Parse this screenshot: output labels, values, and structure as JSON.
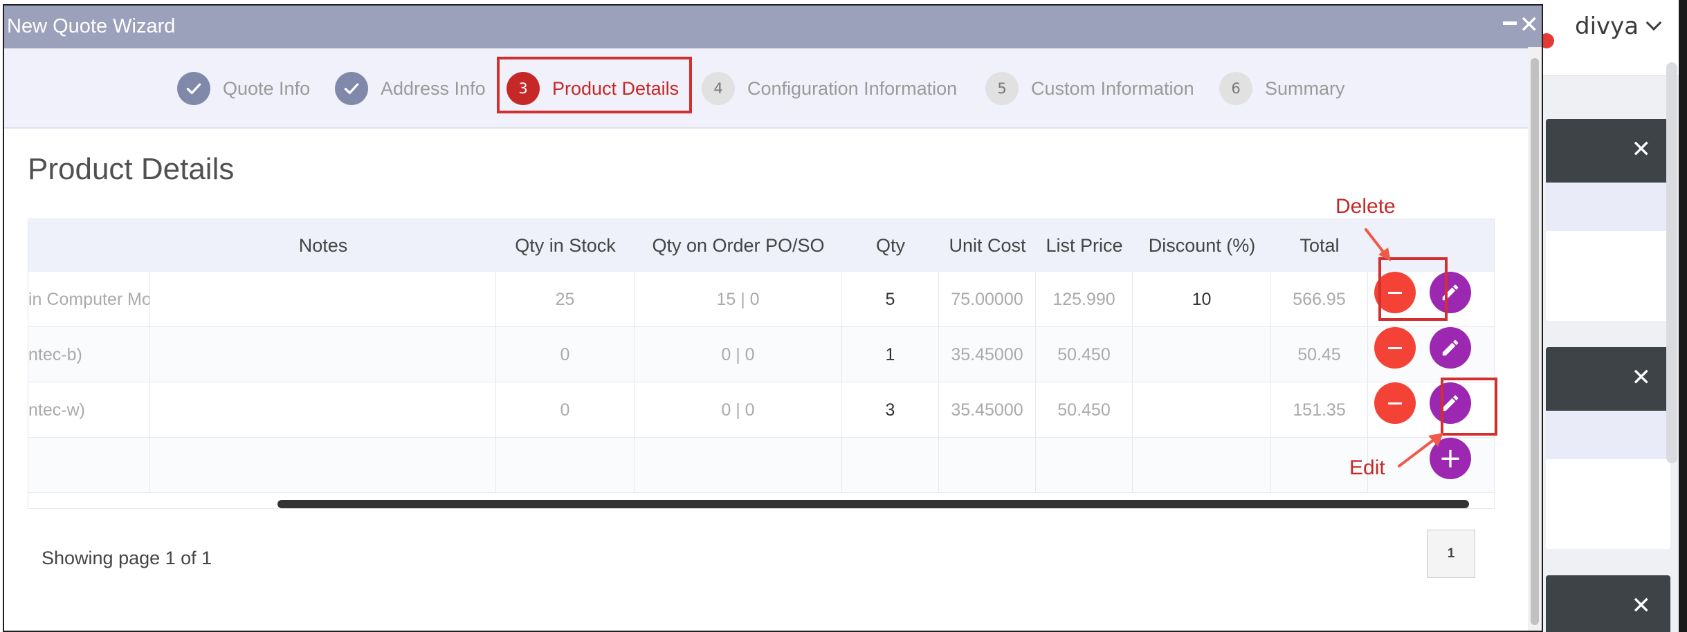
{
  "app": {
    "username": "divya"
  },
  "modal": {
    "title": "New Quote Wizard",
    "minimize_icon": "minimize-icon",
    "close_icon": "close-icon"
  },
  "wizard": {
    "steps": [
      {
        "number": "1",
        "label": "Quote Info",
        "state": "done"
      },
      {
        "number": "2",
        "label": "Address Info",
        "state": "done"
      },
      {
        "number": "3",
        "label": "Product Details",
        "state": "active"
      },
      {
        "number": "4",
        "label": "Configuration Information",
        "state": "pending"
      },
      {
        "number": "5",
        "label": "Custom Information",
        "state": "pending"
      },
      {
        "number": "6",
        "label": "Summary",
        "state": "pending"
      }
    ]
  },
  "section": {
    "title": "Product Details"
  },
  "table": {
    "headers": {
      "notes": "Notes",
      "qty_in_stock": "Qty in Stock",
      "qty_on_order": "Qty on Order PO/SO",
      "qty": "Qty",
      "unit_cost": "Unit Cost",
      "list_price": "List Price",
      "discount": "Discount (%)",
      "total": "Total"
    },
    "rows": [
      {
        "product": "in Computer Mo",
        "notes": "",
        "qty_in_stock": "25",
        "qty_on_order": "15 | 0",
        "qty": "5",
        "unit_cost": "75.00000",
        "list_price": "125.990",
        "discount": "10",
        "total": "566.95"
      },
      {
        "product": "ntec-b)",
        "notes": "",
        "qty_in_stock": "0",
        "qty_on_order": "0 | 0",
        "qty": "1",
        "unit_cost": "35.45000",
        "list_price": "50.450",
        "discount": "",
        "total": "50.45"
      },
      {
        "product": "ntec-w)",
        "notes": "",
        "qty_in_stock": "0",
        "qty_on_order": "0 | 0",
        "qty": "3",
        "unit_cost": "35.45000",
        "list_price": "50.450",
        "discount": "",
        "total": "151.35"
      }
    ]
  },
  "annotations": {
    "delete": "Delete",
    "edit": "Edit"
  },
  "pagination": {
    "text": "Showing page 1 of 1",
    "current_page": "1"
  },
  "colors": {
    "delete": "#f44336",
    "edit": "#9c27b0",
    "highlight": "#d32f2f",
    "titlebar": "#9ba1bb"
  }
}
